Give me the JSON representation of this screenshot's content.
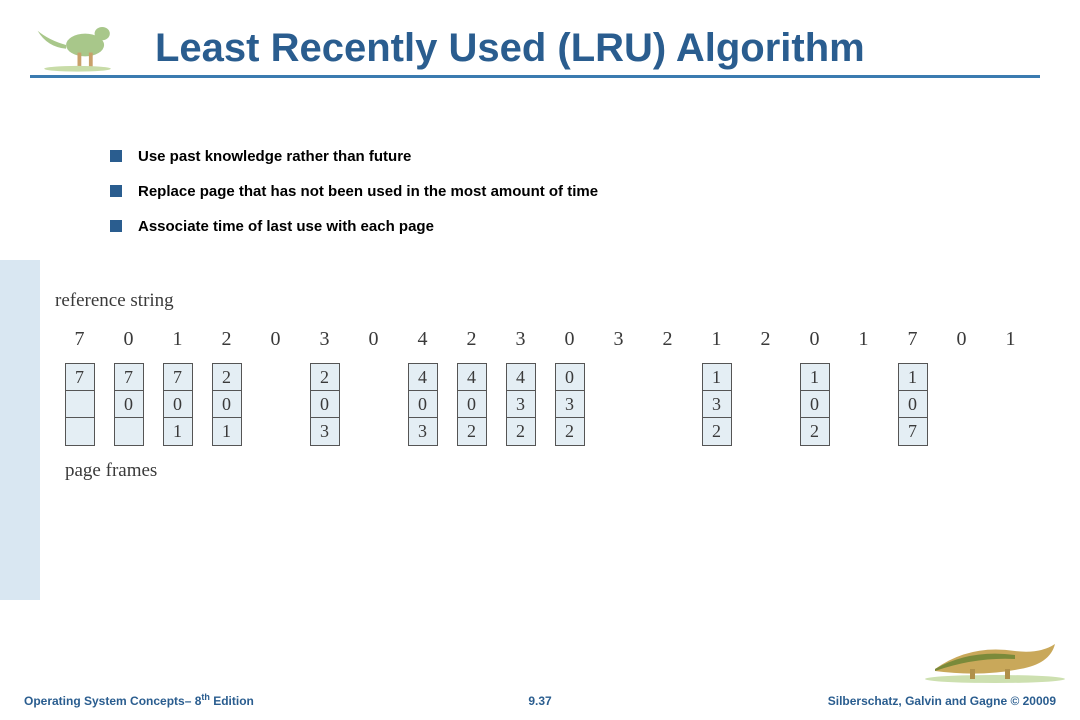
{
  "title": "Least Recently Used (LRU) Algorithm",
  "bullets": [
    "Use past knowledge rather than future",
    "Replace page that has not been used in the most amount of time",
    "Associate time of last use with each page"
  ],
  "diagram": {
    "ref_label": "reference string",
    "reference": [
      "7",
      "0",
      "1",
      "2",
      "0",
      "3",
      "0",
      "4",
      "2",
      "3",
      "0",
      "3",
      "2",
      "1",
      "2",
      "0",
      "1",
      "7",
      "0",
      "1"
    ],
    "frames": [
      [
        "7",
        "",
        ""
      ],
      [
        "7",
        "0",
        ""
      ],
      [
        "7",
        "0",
        "1"
      ],
      [
        "2",
        "0",
        "1"
      ],
      null,
      [
        "2",
        "0",
        "3"
      ],
      null,
      [
        "4",
        "0",
        "3"
      ],
      [
        "4",
        "0",
        "2"
      ],
      [
        "4",
        "3",
        "2"
      ],
      [
        "0",
        "3",
        "2"
      ],
      null,
      null,
      [
        "1",
        "3",
        "2"
      ],
      null,
      [
        "1",
        "0",
        "2"
      ],
      null,
      [
        "1",
        "0",
        "7"
      ],
      null,
      null
    ],
    "pf_label": "page frames"
  },
  "footer": {
    "left_a": "Operating System Concepts– 8",
    "left_sup": "th",
    "left_b": " Edition",
    "mid": "9.37",
    "right": "Silberschatz, Galvin and Gagne © 20009"
  }
}
